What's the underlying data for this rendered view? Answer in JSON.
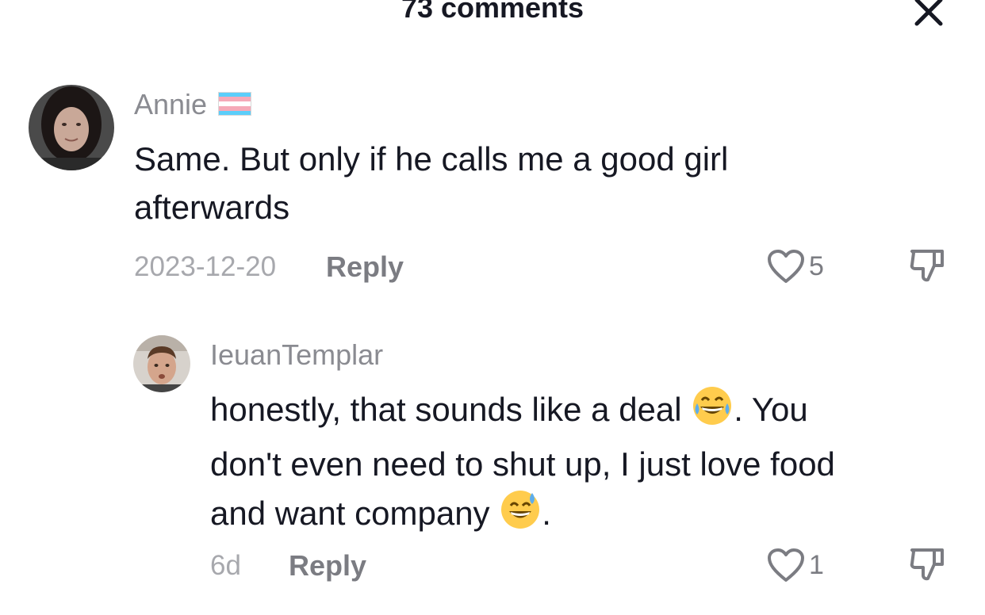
{
  "header": {
    "title": "73 comments",
    "close_icon": "close-icon"
  },
  "comments": [
    {
      "username": "Annie",
      "badge_icon": "trans-flag-icon",
      "text_line1": "Same. But only if he calls me a good girl",
      "text_line2": "afterwards",
      "date": "2023-12-20",
      "reply_label": "Reply",
      "likes": "5"
    },
    {
      "username": "IeuanTemplar",
      "text_part1": "honestly, that sounds like a deal",
      "emoji1": "laughing-tears-emoji",
      "text_part2": ". You",
      "text_line2": "don't even need to shut up, I just love food",
      "text_part3": "and want company",
      "emoji2": "sweat-smile-emoji",
      "text_part4": ".",
      "date": "6d",
      "reply_label": "Reply",
      "likes": "1"
    }
  ],
  "colors": {
    "text": "#161823",
    "username": "#8a8b91",
    "meta": "#a7a8ad",
    "flag_blue": "#5BCEFA",
    "flag_pink": "#F5A9B8"
  }
}
